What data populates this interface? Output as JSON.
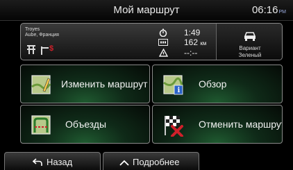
{
  "header": {
    "title": "Мой маршрут",
    "time": "06:16",
    "ampm": "PM"
  },
  "summary": {
    "destination_city": "Troyes",
    "destination_region": "Aube, Франция",
    "duration": "1:49",
    "distance_value": "162",
    "distance_unit": "км",
    "arrival": "--:--",
    "variant_line1": "Вариант",
    "variant_line2": "Зеленый"
  },
  "menu": {
    "change_route": "Изменить маршрут",
    "overview": "Обзор",
    "detours": "Объезды",
    "cancel_route": "Отменить маршрут"
  },
  "footer": {
    "back": "Назад",
    "more": "Подробнее"
  },
  "colors": {
    "accent_green": "#1f5a30",
    "cancel_red": "#d0202a"
  }
}
